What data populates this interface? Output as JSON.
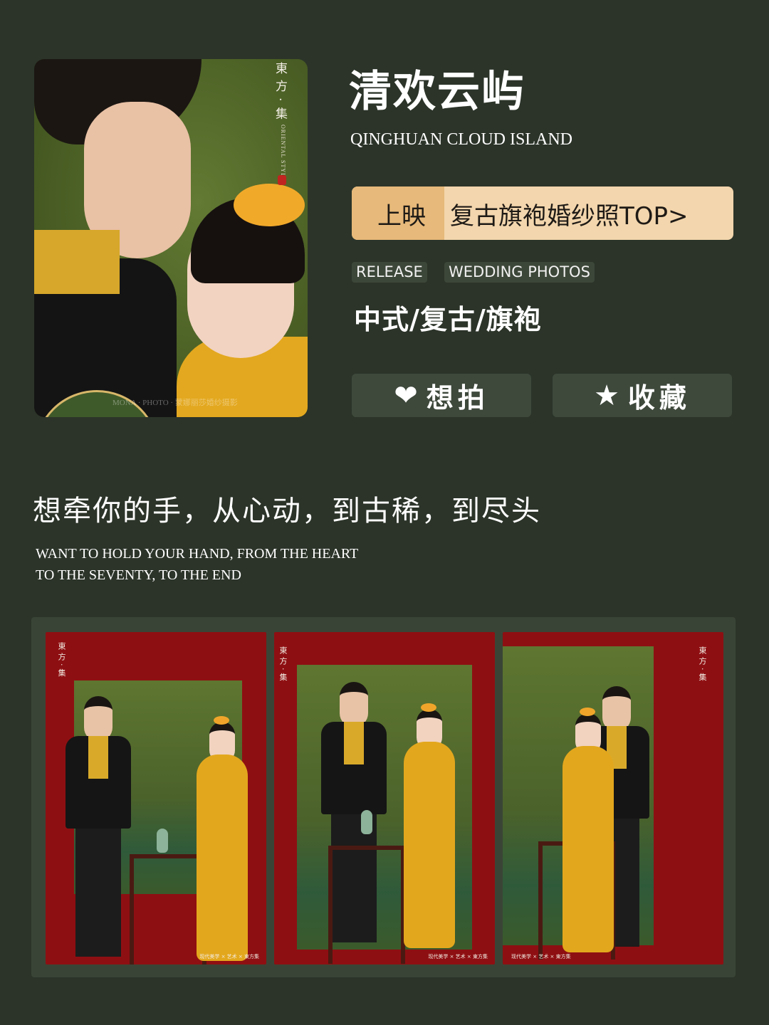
{
  "hero": {
    "badge": "東方·集",
    "badge_en": "ORIENTAL STYLE",
    "watermark": "MONA · PHOTO · 蒙娜丽莎婚纱摄影"
  },
  "header": {
    "title": "清欢云屿",
    "subtitle": "QINGHUAN CLOUD ISLAND"
  },
  "release": {
    "tag": "上映",
    "slogan": "复古旗袍婚纱照TOP>"
  },
  "chips": [
    "RELEASE",
    "WEDDING PHOTOS"
  ],
  "styles": "中式/复古/旗袍",
  "actions": {
    "like_icon": "heart-icon",
    "like_glyph": "❤",
    "like_label": "想拍",
    "fav_icon": "star-icon",
    "fav_glyph": "★",
    "fav_label": "收藏"
  },
  "quote": {
    "cn": "想牵你的手，从心动，到古稀，到尽头",
    "en_line1": "WANT TO HOLD YOUR HAND, FROM THE HEART",
    "en_line2": "TO THE SEVENTY, TO THE END"
  },
  "gallery": {
    "mark": "東方·集",
    "credit": "现代美学 × 艺术 × 東方集"
  },
  "colors": {
    "background": "#2c3429",
    "release_bar": "#f3d6ad",
    "release_tag": "#e7b97a",
    "button": "#3e483b",
    "gallery_red": "#8e0f12"
  }
}
